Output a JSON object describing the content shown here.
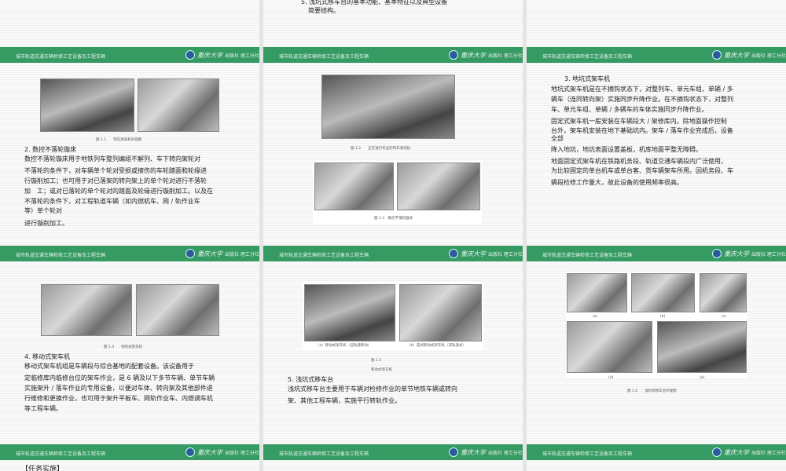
{
  "footer": {
    "title": "城市轨道交通车辆检修工艺设备及工程车辆",
    "brand": "重庆大学",
    "publisher": "出版社 理工分社"
  },
  "s_top2": {
    "lines": [
      "5. 浅坑式移车台的基本功能、基本特征以及典型设备",
      "简要结构。"
    ]
  },
  "s1": {
    "caption": "图 1.1　　列车清洗机外观图",
    "heading": "2. 数控不落轮镟床",
    "lines": [
      "数控不落轮镟床用于地铁列车整列编组不解列、车下转向架轮对",
      "不落轮的条件下，对车辆单个轮对受损或擦伤的车轮踏面和轮缘进",
      "行镟削加工；也可用于对已落架的转向架上的单个轮对进行不落轮",
      "加　工；或对已落轮的单个轮对的踏面及轮缘进行镟削加工。以及在",
      "不落轮的条件下，对工程轨道车辆（如内燃机车、网 / 轨作业车",
      "等）单个轮对",
      "进行镟削加工。"
    ]
  },
  "s2": {
    "caption1": "图 1.2　　正在进行作业的列车清洗机",
    "caption2": "图 1.3　数控不落轮镟床"
  },
  "s3": {
    "heading": "3. 地坑式架车机",
    "lines": [
      "地坑式架车机是在不摘钩状态下，对整列车、单元车组、单辆 / 多",
      "辆车（连同转向架）实施同步升降作业。在不摘钩状态下，对整列",
      "车、单元车组、单辆 / 多辆车的车体实施同步升降作业。",
      "固定式架车机一般安装在车辆段大 / 架修库内。除地面操作控制",
      "台外，架车机安装在地下基础坑内。架车 / 落车作业完成后，设备",
      "全部",
      "降入地坑，地坑表面设置盖板，机库地面平整无障碍。",
      "地面固定式架车机在铁路机务段、轨道交通车辆段内广泛使用，",
      "为比较固定的单台机车或单台客、货车辆架车所用。因机务段、车",
      "辆段检修工作量大，故此设备的使用频率很高。"
    ]
  },
  "s4": {
    "caption": "图 1.4　　地坑式架车机",
    "heading": "4. 移动式架车机",
    "lines": [
      "移动式架车机组是车辆段与综合基地的配套设备。该设备用于",
      "定临修库内临修台位的架车作业，是 6 辆及以下多节车辆、单节车辆",
      "实施架升 / 落车作业的专用设备，以便对车体、转向架及其他部件进",
      "行维修和更换作业，也可用于架升平板车、网轨作业车、内燃调车机",
      "等工程车辆。"
    ]
  },
  "s5": {
    "sub_a": "（a）移动式架车机（沿轨道移动）",
    "sub_b": "（b）成式移动式架车机（非轨道式）",
    "fig": "图 1.5",
    "caption": "移动式架车机",
    "heading": "5. 浅坑式移车台",
    "lines": [
      "浅坑式移车台主要用于车辆对检修作业的单节地铁车辆或转向",
      "架、其他工程车辆，实施平行转轨作业。"
    ]
  },
  "s6": {
    "labels": [
      "(a)",
      "(b)",
      "(c)",
      "(d)",
      "(e)"
    ],
    "caption": "图 1.6　　浅坑式移车台外观图"
  },
  "s7": {
    "heading": "【任务实施】"
  }
}
